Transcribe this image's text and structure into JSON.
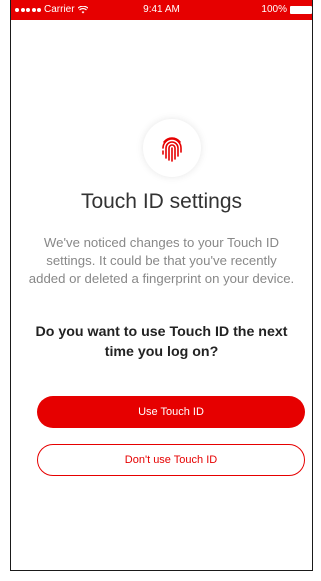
{
  "status_bar": {
    "carrier": "Carrier",
    "time": "9:41 AM",
    "battery": "100%"
  },
  "icons": {
    "fingerprint": "fingerprint-icon",
    "wifi": "wifi-icon",
    "battery": "battery-icon",
    "signal": "signal-dots-icon"
  },
  "screen": {
    "title": "Touch ID settings",
    "description": "We've noticed changes to your Touch ID settings. It could be that you've recently added or deleted a fingerprint on your device.",
    "question": "Do you want to use Touch ID the next time you log on?"
  },
  "actions": {
    "use_touch_id": "Use Touch ID",
    "dont_use_touch_id": "Don't use Touch ID"
  },
  "colors": {
    "accent": "#e60000",
    "title_text": "#333333",
    "description_text": "#888888",
    "question_text": "#222222"
  }
}
